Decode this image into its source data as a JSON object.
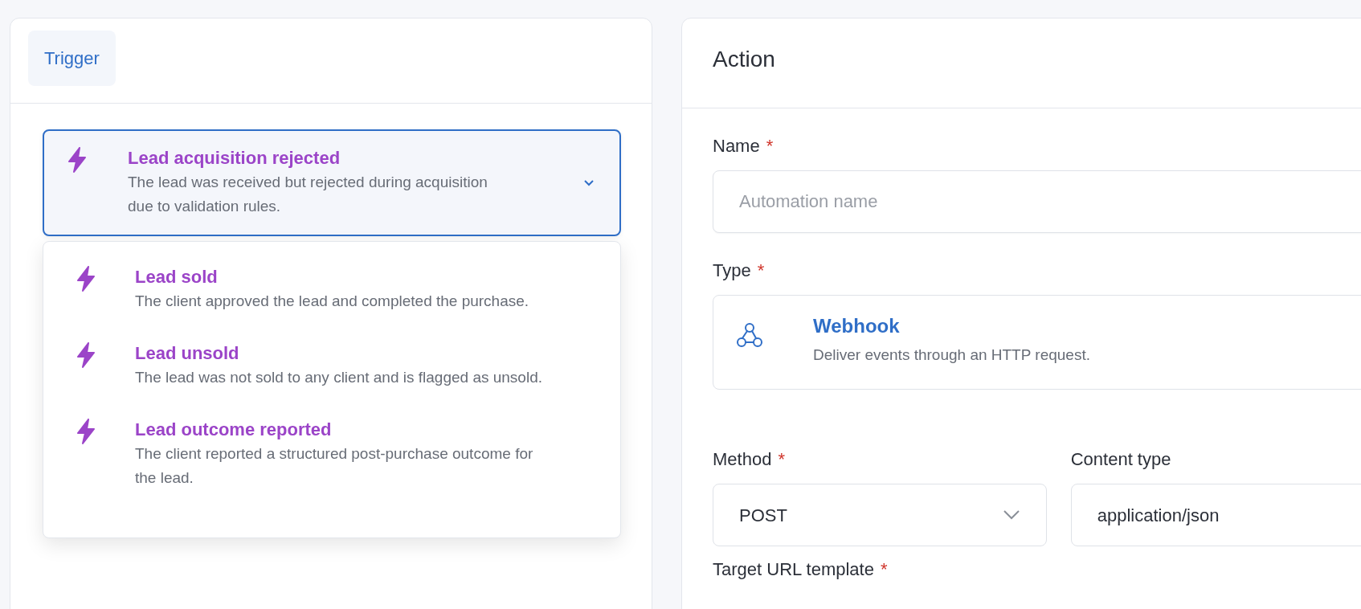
{
  "trigger_panel": {
    "tabs": [
      {
        "label": "Trigger",
        "selected": true
      }
    ],
    "selected_event": {
      "title": "Lead acquisition rejected",
      "description": "The lead was received but rejected during acquisition due to validation rules.",
      "expanded": true
    },
    "options": [
      {
        "title": "Lead sold",
        "description": "The client approved the lead and completed the purchase."
      },
      {
        "title": "Lead unsold",
        "description": "The lead was not sold to any client and is flagged as unsold."
      },
      {
        "title": "Lead outcome reported",
        "description": "The client reported a structured post-purchase outcome for the lead."
      }
    ]
  },
  "action_panel": {
    "title": "Action",
    "name_field": {
      "label": "Name",
      "required_mark": "*",
      "placeholder": "Automation name"
    },
    "type_field": {
      "label": "Type",
      "required_mark": "*",
      "option": {
        "title": "Webhook",
        "description": "Deliver events through an HTTP request."
      }
    },
    "method_field": {
      "label": "Method",
      "required_mark": "*",
      "value": "POST"
    },
    "content_type_field": {
      "label": "Content type",
      "value": "application/json"
    },
    "target_url_field": {
      "label": "Target URL template",
      "required_mark": "*"
    }
  }
}
